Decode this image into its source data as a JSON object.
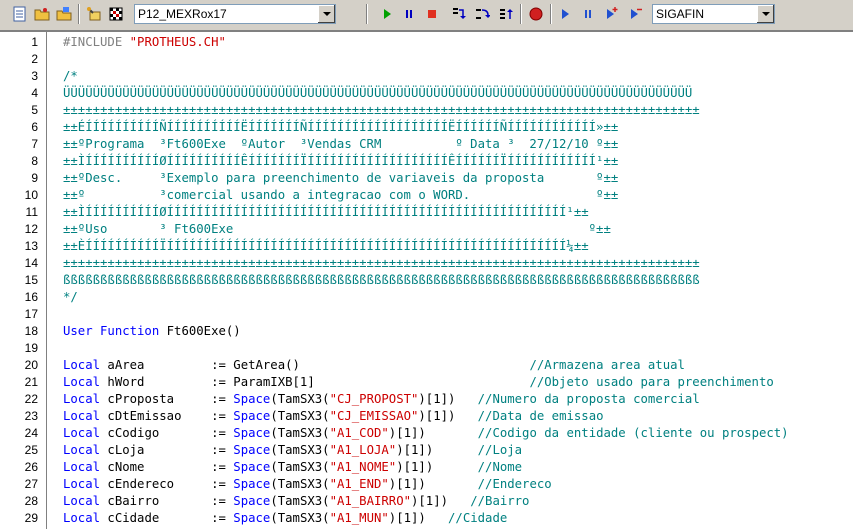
{
  "toolbar": {
    "environment_combo": "P12_MEXRox17",
    "company_combo": "SIGAFIN",
    "icons": [
      "new-file-icon",
      "open-folder-icon",
      "open-project-icon",
      "compile-icon",
      "checkered-flag-icon",
      "run-icon",
      "pause-icon",
      "stop-icon",
      "step-into-icon",
      "step-over-icon",
      "step-out-icon",
      "breakpoint-icon",
      "play-icon",
      "pause-small-icon",
      "add-watch-icon",
      "remove-watch-icon"
    ]
  },
  "editor": {
    "lines": [
      {
        "n": "1",
        "segs": [
          {
            "c": "pp",
            "t": "#INCLUDE "
          },
          {
            "c": "str",
            "t": "\"PROTHEUS.CH\""
          }
        ]
      },
      {
        "n": "2",
        "segs": []
      },
      {
        "n": "3",
        "segs": [
          {
            "c": "cmt",
            "t": "/*"
          }
        ]
      },
      {
        "n": "4",
        "segs": [
          {
            "c": "cmt",
            "t": "ÜÜÜÜÜÜÜÜÜÜÜÜÜÜÜÜÜÜÜÜÜÜÜÜÜÜÜÜÜÜÜÜÜÜÜÜÜÜÜÜÜÜÜÜÜÜÜÜÜÜÜÜÜÜÜÜÜÜÜÜÜÜÜÜÜÜÜÜÜÜÜÜÜÜÜÜÜÜÜÜÜÜÜÜÜ"
          }
        ]
      },
      {
        "n": "5",
        "segs": [
          {
            "c": "cmt",
            "t": "±±±±±±±±±±±±±±±±±±±±±±±±±±±±±±±±±±±±±±±±±±±±±±±±±±±±±±±±±±±±±±±±±±±±±±±±±±±±±±±±±±±±±±"
          }
        ]
      },
      {
        "n": "6",
        "segs": [
          {
            "c": "cmt",
            "t": "±±ÉÍÍÍÍÍÍÍÍÍÍÑÍÍÍÍÍÍÍÍÍÍËÍÍÍÍÍÍÍÑÍÍÍÍÍÍÍÍÍÍÍÍÍÍÍÍÍÍÍËÍÍÍÍÍÍÑÍÍÍÍÍÍÍÍÍÍÍÍ»±±"
          }
        ]
      },
      {
        "n": "7",
        "segs": [
          {
            "c": "cmt",
            "t": "±±ºPrograma  ³Ft600Exe  ºAutor  ³Vendas CRM          º Data ³  27/12/10 º±±"
          }
        ]
      },
      {
        "n": "8",
        "segs": [
          {
            "c": "cmt",
            "t": "±±ÌÍÍÍÍÍÍÍÍÍÍØÍÍÍÍÍÍÍÍÍÍÊÍÍÍÍÍÍÍÏÍÍÍÍÍÍÍÍÍÍÍÍÍÍÍÍÍÍÍÊÍÍÍÍÍÍÏÍÍÍÍÍÍÍÍÍÍÍÍ¹±±"
          }
        ]
      },
      {
        "n": "9",
        "segs": [
          {
            "c": "cmt",
            "t": "±±ºDesc.     ³Exemplo para preenchimento de variaveis da proposta       º±±"
          }
        ]
      },
      {
        "n": "10",
        "segs": [
          {
            "c": "cmt",
            "t": "±±º          ³comercial usando a integracao com o WORD.                 º±±"
          }
        ]
      },
      {
        "n": "11",
        "segs": [
          {
            "c": "cmt",
            "t": "±±ÌÍÍÍÍÍÍÍÍÍÍØÍÍÍÍÍÍÍÍÍÍÍÍÍÍÍÍÍÍÍÍÍÍÍÍÍÍÍÍÍÍÍÍÍÍÍÍÍÍÍÍÍÍÍÍÍÍÍÍÍÍÍÍÍÍ¹±±"
          }
        ]
      },
      {
        "n": "12",
        "segs": [
          {
            "c": "cmt",
            "t": "±±ºUso       ³ Ft600Exe                                                º±±"
          }
        ]
      },
      {
        "n": "13",
        "segs": [
          {
            "c": "cmt",
            "t": "±±ÈÍÍÍÍÍÍÍÍÍÍÏÍÍÍÍÍÍÍÍÍÍÍÍÍÍÍÍÍÍÍÍÍÍÍÍÍÍÍÍÍÍÍÍÍÍÍÍÍÍÍÍÍÍÍÍÍÍÍÍÍÍÍÍÍÍ¼±±"
          }
        ]
      },
      {
        "n": "14",
        "segs": [
          {
            "c": "cmt",
            "t": "±±±±±±±±±±±±±±±±±±±±±±±±±±±±±±±±±±±±±±±±±±±±±±±±±±±±±±±±±±±±±±±±±±±±±±±±±±±±±±±±±±±±±±"
          }
        ]
      },
      {
        "n": "15",
        "segs": [
          {
            "c": "cmt",
            "t": "ßßßßßßßßßßßßßßßßßßßßßßßßßßßßßßßßßßßßßßßßßßßßßßßßßßßßßßßßßßßßßßßßßßßßßßßßßßßßßßßßßßßßßß"
          }
        ]
      },
      {
        "n": "16",
        "segs": [
          {
            "c": "cmt",
            "t": "*/"
          }
        ]
      },
      {
        "n": "17",
        "segs": []
      },
      {
        "n": "18",
        "segs": [
          {
            "c": "kw",
            "t": "User Function"
          },
          {
            "c": "",
            "t": " Ft600Exe()"
          }
        ]
      },
      {
        "n": "19",
        "segs": []
      },
      {
        "n": "20",
        "segs": [
          {
            "c": "kw",
            "t": "Local"
          },
          {
            "c": "",
            "t": " aArea         := GetArea()                               "
          },
          {
            "c": "cmt",
            "t": "//Armazena area atual"
          }
        ]
      },
      {
        "n": "21",
        "segs": [
          {
            "c": "kw",
            "t": "Local"
          },
          {
            "c": "",
            "t": " hWord         := ParamIXB[1]                             "
          },
          {
            "c": "cmt",
            "t": "//Objeto usado para preenchimento"
          }
        ]
      },
      {
        "n": "22",
        "segs": [
          {
            "c": "kw",
            "t": "Local"
          },
          {
            "c": "",
            "t": " cProposta     := "
          },
          {
            "c": "kw",
            "t": "Space"
          },
          {
            "c": "",
            "t": "(TamSX3("
          },
          {
            "c": "str",
            "t": "\"CJ_PROPOST\""
          },
          {
            "c": "",
            "t": ")[1])   "
          },
          {
            "c": "cmt",
            "t": "//Numero da proposta comercial"
          }
        ]
      },
      {
        "n": "23",
        "segs": [
          {
            "c": "kw",
            "t": "Local"
          },
          {
            "c": "",
            "t": " cDtEmissao    := "
          },
          {
            "c": "kw",
            "t": "Space"
          },
          {
            "c": "",
            "t": "(TamSX3("
          },
          {
            "c": "str",
            "t": "\"CJ_EMISSAO\""
          },
          {
            "c": "",
            "t": ")[1])   "
          },
          {
            "c": "cmt",
            "t": "//Data de emissao"
          }
        ]
      },
      {
        "n": "24",
        "segs": [
          {
            "c": "kw",
            "t": "Local"
          },
          {
            "c": "",
            "t": " cCodigo       := "
          },
          {
            "c": "kw",
            "t": "Space"
          },
          {
            "c": "",
            "t": "(TamSX3("
          },
          {
            "c": "str",
            "t": "\"A1_COD\""
          },
          {
            "c": "",
            "t": ")[1])       "
          },
          {
            "c": "cmt",
            "t": "//Codigo da entidade (cliente ou prospect)"
          }
        ]
      },
      {
        "n": "25",
        "segs": [
          {
            "c": "kw",
            "t": "Local"
          },
          {
            "c": "",
            "t": " cLoja         := "
          },
          {
            "c": "kw",
            "t": "Space"
          },
          {
            "c": "",
            "t": "(TamSX3("
          },
          {
            "c": "str",
            "t": "\"A1_LOJA\""
          },
          {
            "c": "",
            "t": ")[1])      "
          },
          {
            "c": "cmt",
            "t": "//Loja"
          }
        ]
      },
      {
        "n": "26",
        "segs": [
          {
            "c": "kw",
            "t": "Local"
          },
          {
            "c": "",
            "t": " cNome         := "
          },
          {
            "c": "kw",
            "t": "Space"
          },
          {
            "c": "",
            "t": "(TamSX3("
          },
          {
            "c": "str",
            "t": "\"A1_NOME\""
          },
          {
            "c": "",
            "t": ")[1])      "
          },
          {
            "c": "cmt",
            "t": "//Nome"
          }
        ]
      },
      {
        "n": "27",
        "segs": [
          {
            "c": "kw",
            "t": "Local"
          },
          {
            "c": "",
            "t": " cEndereco     := "
          },
          {
            "c": "kw",
            "t": "Space"
          },
          {
            "c": "",
            "t": "(TamSX3("
          },
          {
            "c": "str",
            "t": "\"A1_END\""
          },
          {
            "c": "",
            "t": ")[1])       "
          },
          {
            "c": "cmt",
            "t": "//Endereco"
          }
        ]
      },
      {
        "n": "28",
        "segs": [
          {
            "c": "kw",
            "t": "Local"
          },
          {
            "c": "",
            "t": " cBairro       := "
          },
          {
            "c": "kw",
            "t": "Space"
          },
          {
            "c": "",
            "t": "(TamSX3("
          },
          {
            "c": "str",
            "t": "\"A1_BAIRRO\""
          },
          {
            "c": "",
            "t": ")[1])   "
          },
          {
            "c": "cmt",
            "t": "//Bairro"
          }
        ]
      },
      {
        "n": "29",
        "segs": [
          {
            "c": "kw",
            "t": "Local"
          },
          {
            "c": "",
            "t": " cCidade       := "
          },
          {
            "c": "kw",
            "t": "Space"
          },
          {
            "c": "",
            "t": "(TamSX3("
          },
          {
            "c": "str",
            "t": "\"A1_MUN\""
          },
          {
            "c": "",
            "t": ")[1])   "
          },
          {
            "c": "cmt",
            "t": "//Cidade"
          }
        ]
      }
    ]
  },
  "colors": {
    "keyword": "#0000ff",
    "string": "#cc0000",
    "comment": "#008080",
    "preprocessor": "#808080"
  }
}
